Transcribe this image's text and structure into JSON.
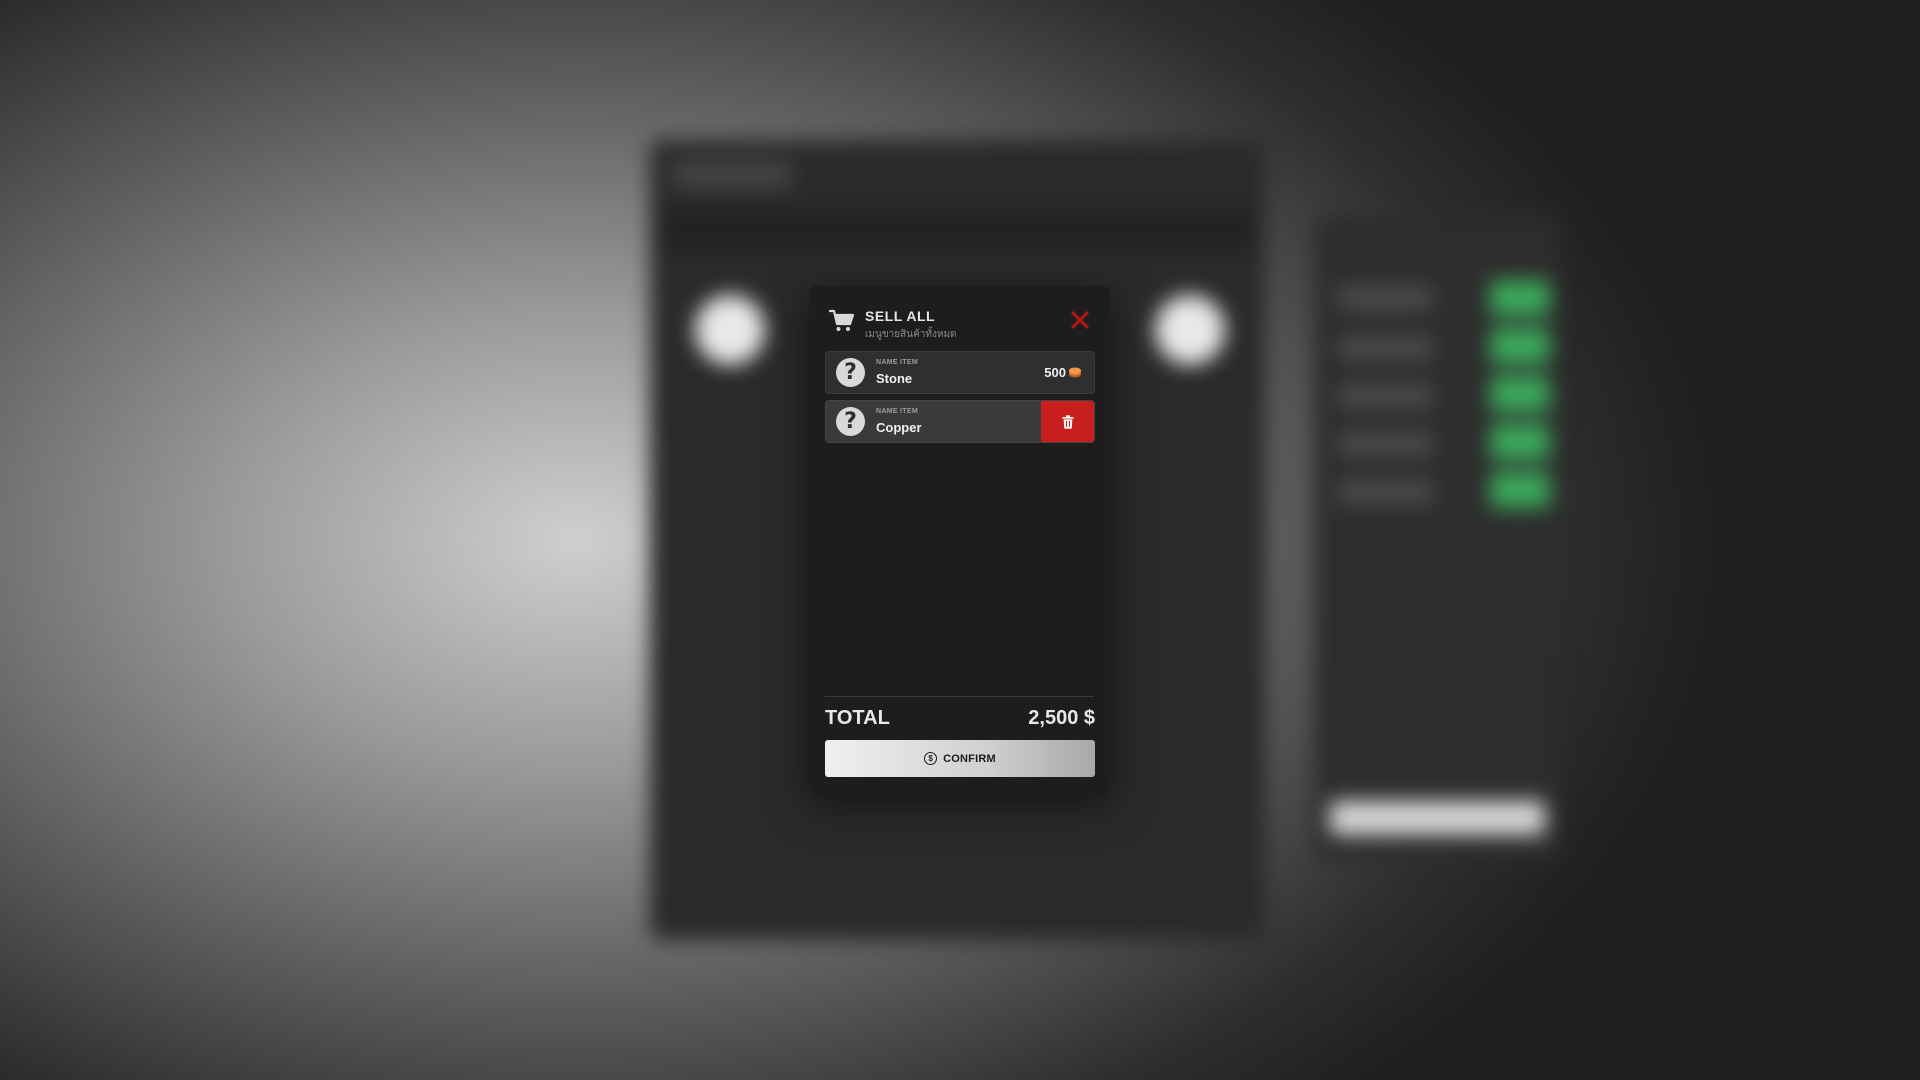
{
  "dialog": {
    "title": "SELL ALL",
    "subtitle": "เมนูขายสินค้าทั้งหมด",
    "icons": {
      "header": "cart-icon",
      "close": "close-icon"
    },
    "items": [
      {
        "caption": "NAME ITEM",
        "name": "Stone",
        "price": "500",
        "avatar": "?",
        "price_icon": "coin-icon",
        "state": "normal"
      },
      {
        "caption": "NAME ITEM",
        "name": "Copper",
        "avatar": "?",
        "action_icon": "trash-icon",
        "state": "hover-delete"
      }
    ],
    "total_label": "TOTAL",
    "total_value": "2,500 $",
    "confirm_label": "CONFIRM",
    "confirm_icon": "dollar-circle-icon"
  },
  "colors": {
    "panel": "#1d1d1d",
    "row": "#2f2f2f",
    "delete": "#c81e1e",
    "close": "#b01818",
    "coin": "#e8823a",
    "background_accent": "#3ca85a"
  }
}
